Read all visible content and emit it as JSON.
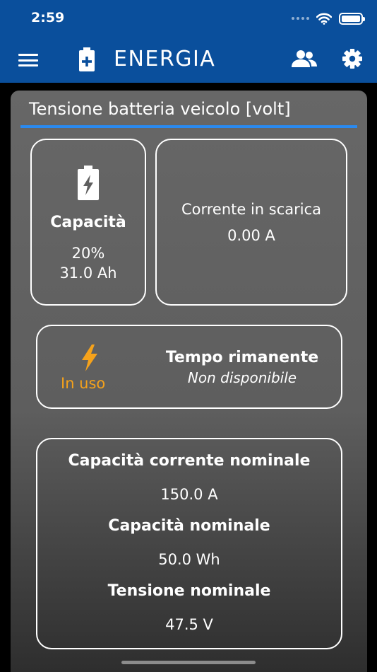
{
  "status_bar": {
    "time": "2:59"
  },
  "app_bar": {
    "title": "ENERGIA",
    "menu_icon": "hamburger-menu-icon",
    "battery_icon": "battery-plus-icon",
    "users_icon": "users-icon",
    "settings_icon": "gear-icon"
  },
  "panel": {
    "title": "Tensione batteria veicolo [volt]"
  },
  "capacity": {
    "label": "Capacità",
    "percent": "20%",
    "amp_hours": "31.0 Ah"
  },
  "current": {
    "label": "Corrente in scarica",
    "value": "0.00 A"
  },
  "time_remaining": {
    "status": "In uso",
    "label": "Tempo rimanente",
    "value": "Non disponibile"
  },
  "nominal": {
    "current_label": "Capacità corrente nominale",
    "current_value": "150.0 A",
    "capacity_label": "Capacità nominale",
    "capacity_value": "50.0 Wh",
    "voltage_label": "Tensione nominale",
    "voltage_value": "47.5 V"
  },
  "colors": {
    "app_bar": "#0a4f9c",
    "accent_underline": "#2a8af0",
    "in_use": "#f5a21b"
  }
}
